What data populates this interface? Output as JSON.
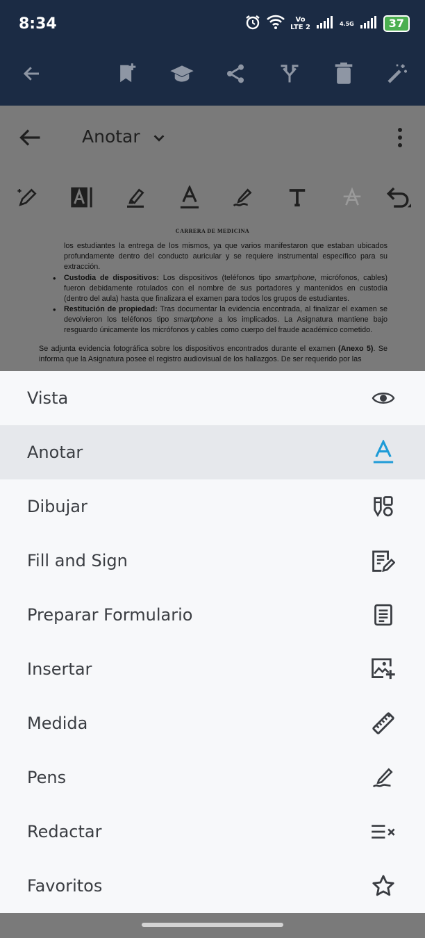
{
  "status_bar": {
    "time": "8:34",
    "network_top": "Vo",
    "network_bottom": "LTE 2",
    "network_2": "4.5G",
    "battery": "37"
  },
  "app_bar": {
    "icons": [
      "back-arrow-icon",
      "bookmark-add-icon",
      "graduation-cap-icon",
      "share-icon",
      "merge-icon",
      "trash-icon",
      "magic-wand-icon"
    ]
  },
  "document_header": {
    "mode": "Anotar"
  },
  "document": {
    "title": "CARRERA DE MEDICINA",
    "para1": "los estudiantes la entrega de los mismos, ya que varios manifestaron que estaban ubicados profundamente dentro del conducto auricular y se requiere instrumental específico para su extracción.",
    "bullet1_bold": "Custodia de dispositivos:",
    "bullet1_a": " Los dispositivos (teléfonos tipo ",
    "bullet1_italic": "smartphone",
    "bullet1_b": ", micrófonos, cables) fueron debidamente rotulados con el nombre de sus portadores y mantenidos en custodia (dentro del aula) hasta que finalizara el examen para todos los grupos de estudiantes.",
    "bullet2_bold": "Restitución de propiedad:",
    "bullet2_a": " Tras documentar la evidencia encontrada, al finalizar el examen se devolvieron los teléfonos tipo ",
    "bullet2_italic": "smartphone",
    "bullet2_b": " a los implicados. La Asignatura mantiene bajo resguardo únicamente los micrófonos y cables como cuerpo del fraude académico cometido.",
    "para2_a": "Se adjunta evidencia fotográfica sobre los dispositivos encontrados durante el examen ",
    "para2_bold": "(Anexo 5)",
    "para2_b": ". Se informa que la Asignatura posee el registro audiovisual de los hallazgos. De ser requerido por las"
  },
  "menu": {
    "items": [
      {
        "label": "Vista",
        "icon": "eye-icon"
      },
      {
        "label": "Anotar",
        "icon": "text-a-icon",
        "active": true
      },
      {
        "label": "Dibujar",
        "icon": "draw-shapes-icon"
      },
      {
        "label": "Fill and Sign",
        "icon": "fill-sign-icon"
      },
      {
        "label": "Preparar Formulario",
        "icon": "form-icon"
      },
      {
        "label": "Insertar",
        "icon": "insert-image-icon"
      },
      {
        "label": "Medida",
        "icon": "ruler-icon"
      },
      {
        "label": "Pens",
        "icon": "pen-icon"
      },
      {
        "label": "Redactar",
        "icon": "redact-icon"
      },
      {
        "label": "Favoritos",
        "icon": "star-icon"
      }
    ]
  },
  "colors": {
    "top_bar": "#1b2b44",
    "accent": "#1e9bd7",
    "sheet": "#f7f8fa",
    "active_row": "#e6e8ec",
    "scrim": "#7a7a7a"
  }
}
